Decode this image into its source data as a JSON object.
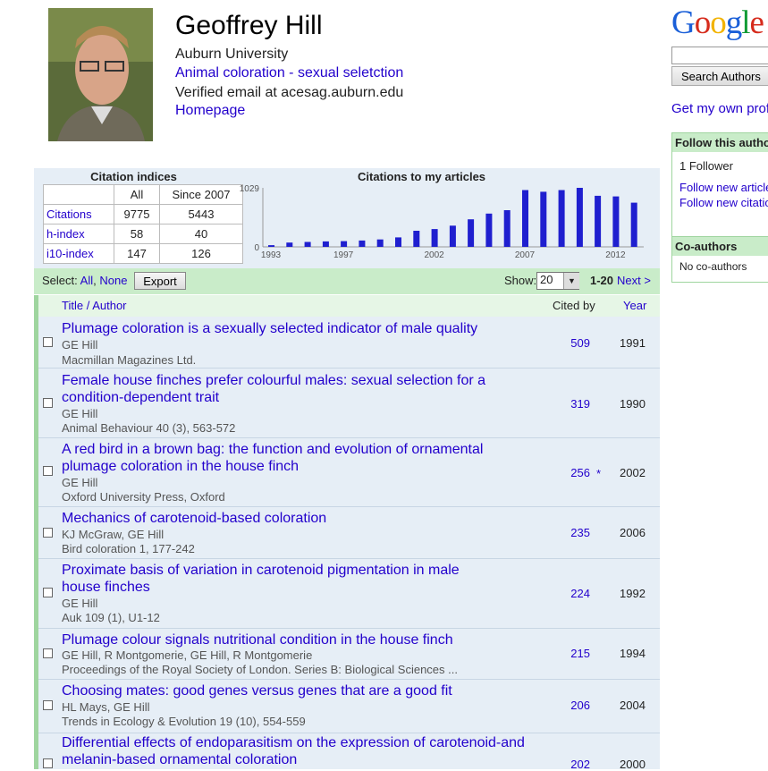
{
  "profile": {
    "name": "Geoffrey Hill",
    "affiliation": "Auburn University",
    "interests": "Animal coloration - sexual seletction",
    "email": "Verified email at acesag.auburn.edu",
    "homepage": "Homepage"
  },
  "sidebar": {
    "logo": "Google",
    "search_button": "Search Authors",
    "get_own_profile": "Get my own profile",
    "follow_title": "Follow this author",
    "followers": "1 Follower",
    "follow_articles": "Follow new articles",
    "follow_citations": "Follow new citations",
    "coauthors_title": "Co-authors",
    "no_coauthors": "No co-authors"
  },
  "citations": {
    "indices_title": "Citation indices",
    "col_all": "All",
    "col_since": "Since 2007",
    "rows": [
      {
        "label": "Citations",
        "all": "9775",
        "since": "5443"
      },
      {
        "label": "h-index",
        "all": "58",
        "since": "40"
      },
      {
        "label": "i10-index",
        "all": "147",
        "since": "126"
      }
    ]
  },
  "chart_data": {
    "type": "bar",
    "title": "Citations to my articles",
    "x": [
      1993,
      1994,
      1995,
      1996,
      1997,
      1998,
      1999,
      2000,
      2001,
      2002,
      2003,
      2004,
      2005,
      2006,
      2007,
      2008,
      2009,
      2010,
      2011,
      2012
    ],
    "values": [
      30,
      75,
      85,
      95,
      100,
      110,
      130,
      165,
      280,
      310,
      370,
      480,
      580,
      640,
      990,
      960,
      990,
      1029,
      890,
      880,
      770
    ],
    "x_tick_labels": [
      "1993",
      "1997",
      "2002",
      "2007",
      "2012"
    ],
    "y_tick_labels": [
      "1029",
      "0"
    ],
    "ylim": [
      0,
      1029
    ],
    "bar_color": "#1f1fcf"
  },
  "toolbar": {
    "select_label": "Select:",
    "select_all": "All",
    "select_none": "None",
    "export": "Export",
    "show_label": "Show:",
    "show_value": "20",
    "range": "1-20",
    "next": "Next >"
  },
  "columns": {
    "title": "Title / Author",
    "cited": "Cited by",
    "year": "Year"
  },
  "articles": [
    {
      "title": "Plumage coloration is a sexually selected indicator of male quality",
      "authors": "GE Hill",
      "source": "Macmillan Magazines Ltd.",
      "cited": "509",
      "year": "1991"
    },
    {
      "title": "Female house finches prefer colourful males: sexual selection for a condition-dependent trait",
      "authors": "GE Hill",
      "source": "Animal Behaviour 40 (3), 563-572",
      "cited": "319",
      "year": "1990"
    },
    {
      "title": "A red bird in a brown bag: the function and evolution of ornamental plumage coloration in the house finch",
      "authors": "GE Hill",
      "source": "Oxford University Press, Oxford",
      "cited": "256",
      "star": "*",
      "year": "2002"
    },
    {
      "title": "Mechanics of carotenoid-based coloration",
      "authors": "KJ McGraw, GE Hill",
      "source": "Bird coloration 1, 177-242",
      "cited": "235",
      "year": "2006"
    },
    {
      "title": "Proximate basis of variation in carotenoid pigmentation in male house finches",
      "authors": "GE Hill",
      "source": "Auk 109 (1), U1-12",
      "cited": "224",
      "year": "1992"
    },
    {
      "title": "Plumage colour signals nutritional condition in the house finch",
      "authors": "GE Hill, R Montgomerie, GE Hill, R Montgomerie",
      "source": "Proceedings of the Royal Society of London. Series B: Biological Sciences ...",
      "cited": "215",
      "year": "1994"
    },
    {
      "title": "Choosing mates: good genes versus genes that are a good fit",
      "authors": "HL Mays, GE Hill",
      "source": "Trends in Ecology & Evolution 19 (10), 554-559",
      "cited": "206",
      "year": "2004"
    },
    {
      "title": "Differential effects of endoparasitism on the expression of carotenoid-and melanin-based ornamental coloration",
      "authors": "",
      "source": "",
      "cited": "202",
      "year": "2000"
    }
  ]
}
